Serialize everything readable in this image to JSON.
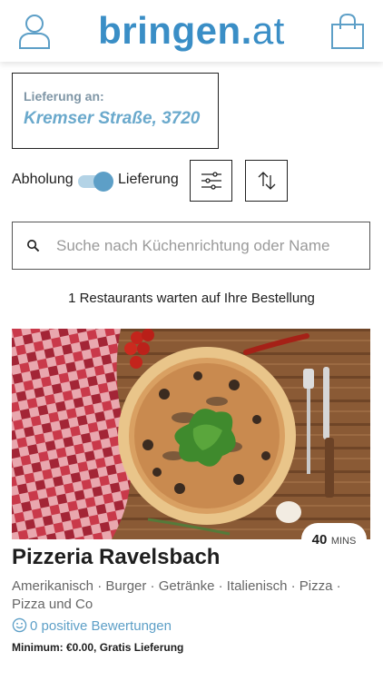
{
  "header": {
    "logo_main": "bringen",
    "logo_dot": ".",
    "logo_tld": "at",
    "left_icon": "user-icon",
    "right_icon": "shopping-bag-icon"
  },
  "delivery": {
    "label": "Lieferung an:",
    "address": "Kremser Straße, 3720"
  },
  "mode": {
    "pickup_label": "Abholung",
    "delivery_label": "Lieferung",
    "selected": "Lieferung",
    "filter_icon": "sliders-icon",
    "sort_icon": "sort-arrows-icon"
  },
  "search": {
    "placeholder": "Suche nach Küchenrichtung oder Name",
    "icon": "search-icon"
  },
  "results": {
    "count_text": "1 Restaurants warten auf Ihre Bestellung"
  },
  "restaurant": {
    "name": "Pizzeria Ravelsbach",
    "cuisines": "Amerikanisch · Burger · Getränke · Italienisch · Pizza · Pizza und Co",
    "time_value": "40",
    "time_unit": "MINS",
    "reviews": "0 positive Bewertungen",
    "minimum": "Minimum: €0.00, Gratis Lieferung"
  },
  "colors": {
    "brand": "#3a8ec6",
    "address": "#6aa9cc",
    "toggle": "#5d9fc7"
  }
}
